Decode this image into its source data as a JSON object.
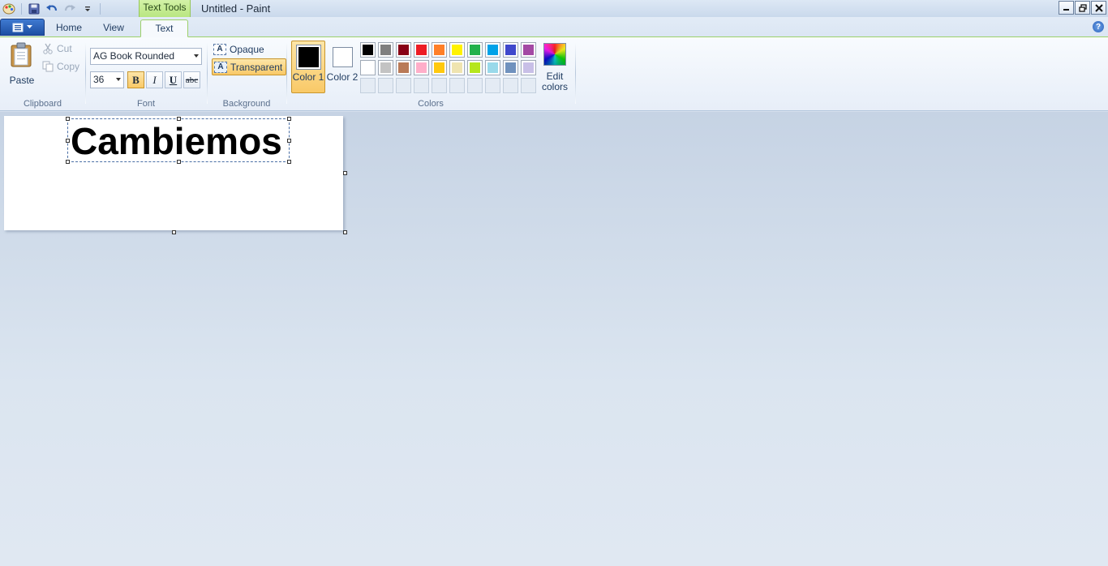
{
  "window": {
    "title": "Untitled - Paint",
    "context_tab": "Text Tools"
  },
  "tabs": [
    {
      "label": "Home"
    },
    {
      "label": "View"
    },
    {
      "label": "Text",
      "active": true
    }
  ],
  "ribbon": {
    "clipboard": {
      "paste": "Paste",
      "cut": "Cut",
      "copy": "Copy",
      "label": "Clipboard"
    },
    "font": {
      "family": "AG Book Rounded",
      "size": "36",
      "bold": "B",
      "italic": "I",
      "underline": "U",
      "strike": "abc",
      "label": "Font"
    },
    "background": {
      "opaque": "Opaque",
      "transparent": "Transparent",
      "label": "Background"
    },
    "colors": {
      "color1": "Color 1",
      "color2": "Color 2",
      "color1_value": "#000000",
      "color2_value": "#ffffff",
      "edit": "Edit colors",
      "label": "Colors",
      "palette": [
        "#000000",
        "#7f7f7f",
        "#880015",
        "#ed1c24",
        "#ff7f27",
        "#fff200",
        "#22b14c",
        "#00a2e8",
        "#3f48cc",
        "#a349a4",
        "#ffffff",
        "#c3c3c3",
        "#b97a57",
        "#ffaec9",
        "#ffc90e",
        "#efe4b0",
        "#b5e61d",
        "#99d9ea",
        "#7092be",
        "#c8bfe7"
      ]
    }
  },
  "canvas": {
    "text": "Cambiemos"
  }
}
